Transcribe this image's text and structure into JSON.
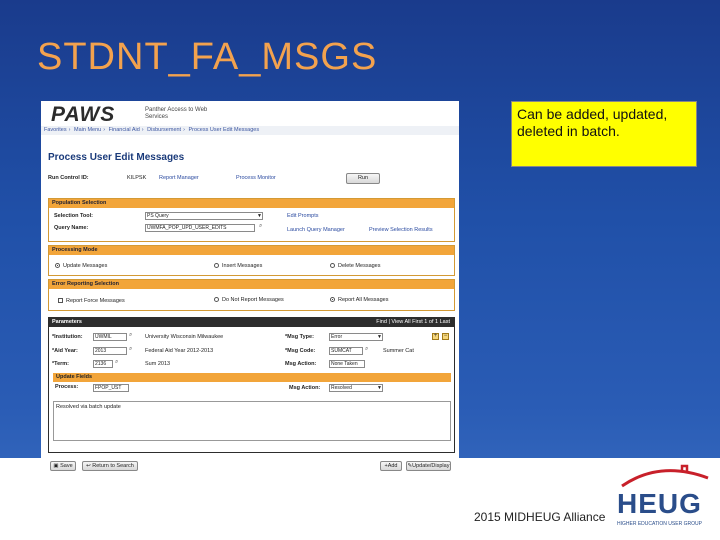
{
  "slide": {
    "title": "STDNT_FA_MSGS",
    "callout": "Can be added, updated, deleted in batch.",
    "footer": "2015 MIDHEUG Alliance",
    "logo_word": "HEUG",
    "logo_sub": "HIGHER EDUCATION USER GROUP"
  },
  "shot": {
    "brand": "PAWS",
    "brand_tag": "Panther Access to Web Services",
    "breadcrumbs": [
      "Favorites",
      "Main Menu",
      "Financial Aid",
      "Disbursement",
      "Process User Edit Messages"
    ],
    "page_title": "Process User Edit Messages",
    "run_control": {
      "label": "Run Control ID:",
      "value": "KILPSK",
      "report_manager": "Report Manager",
      "process_monitor": "Process Monitor",
      "run_button": "Run"
    },
    "population": {
      "header": "Population Selection",
      "selection_tool_label": "Selection Tool:",
      "selection_tool_value": "PS Query",
      "query_name_label": "Query Name:",
      "query_name_value": "UWMFA_POP_UPD_USER_EDITS",
      "edit_prompts": "Edit Prompts",
      "launch_query": "Launch Query Manager",
      "preview": "Preview Selection Results"
    },
    "processing": {
      "header": "Processing Mode",
      "update": "Update Messages",
      "insert": "Insert Messages",
      "delete": "Delete Messages"
    },
    "error_reporting": {
      "header": "Error Reporting Selection",
      "report_force": "Report Force Messages",
      "do_not_report": "Do Not Report Messages",
      "report_all": "Report All Messages"
    },
    "parameters": {
      "header": "Parameters",
      "nav": "Find | View All    First  1 of 1  Last",
      "institution_label": "*Institution:",
      "institution_value": "UWMIL",
      "institution_desc": "University Wisconsin Milwaukee",
      "aid_year_label": "*Aid Year:",
      "aid_year_value": "2013",
      "aid_year_desc": "Federal Aid Year 2012-2013",
      "term_label": "*Term:",
      "term_value": "2136",
      "term_desc": "Sum 2013",
      "msg_type_label": "*Msg Type:",
      "msg_type_value": "Error",
      "msg_code_label": "*Msg Code:",
      "msg_code_value": "SUMCAT",
      "msg_code_desc": "Summer Cat",
      "msg_action_label": "Msg Action:",
      "msg_action_value": "None Taken"
    },
    "update_fields": {
      "header": "Update Fields",
      "process_label": "Process:",
      "process_value": "FPOP_UST",
      "msg_action_label": "Msg Action:",
      "msg_action_value": "Resolved",
      "comment": "Resolved via batch update"
    },
    "footer_buttons": {
      "save": "Save",
      "return": "Return to Search",
      "add": "Add",
      "update_display": "Update/Display"
    }
  }
}
